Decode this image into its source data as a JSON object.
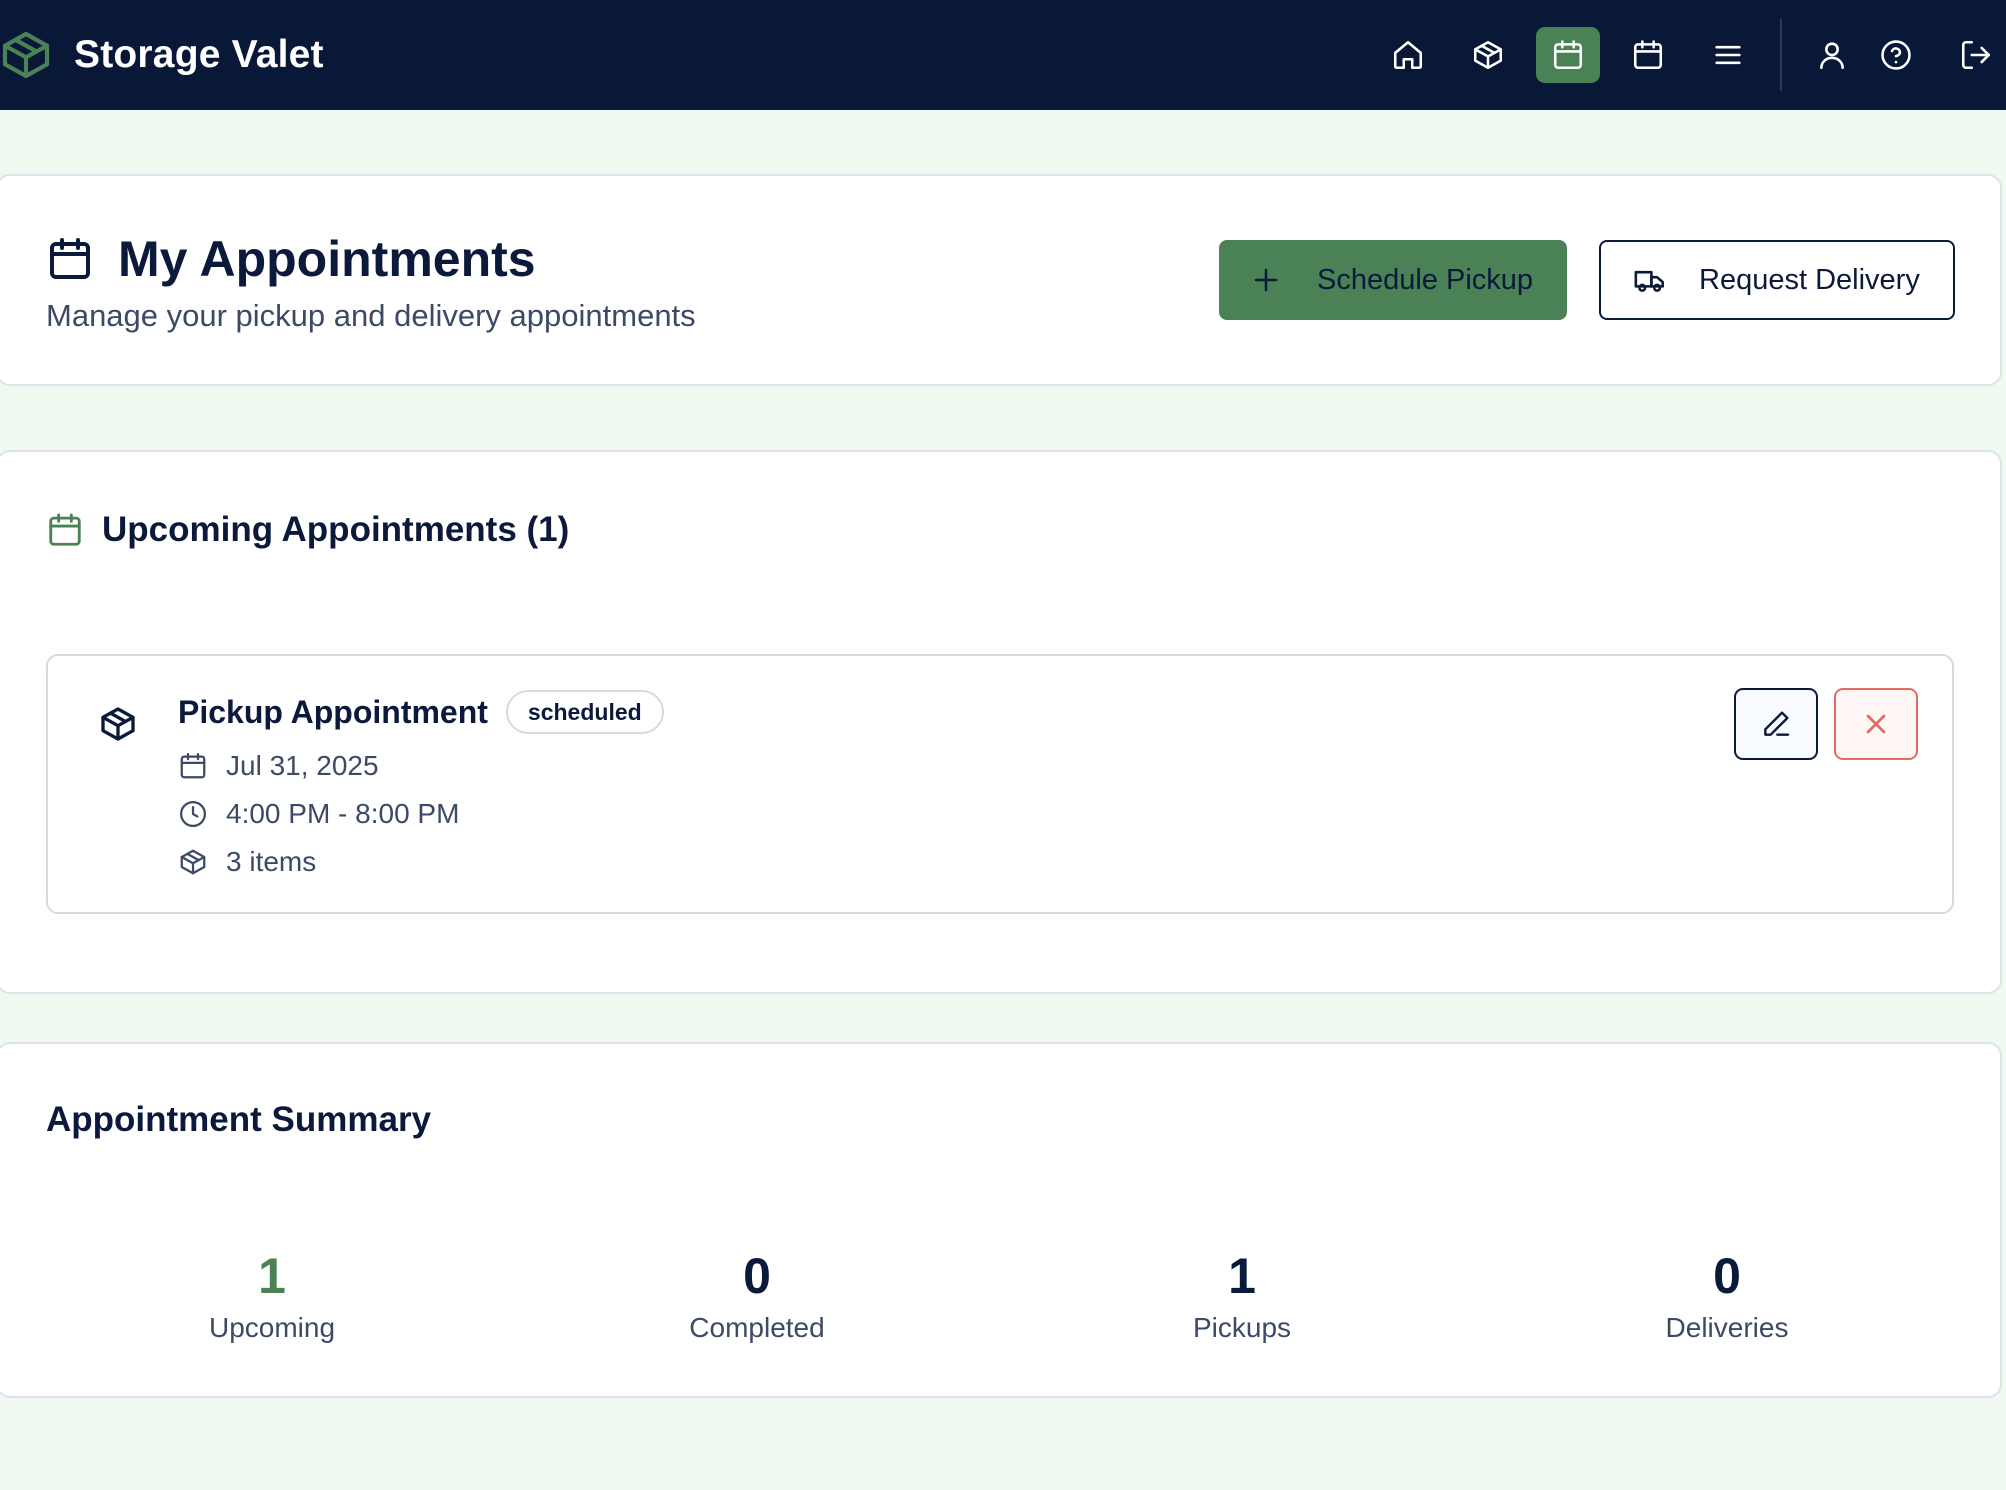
{
  "app": {
    "name": "Storage Valet",
    "logo_icon": "package-icon"
  },
  "nav": {
    "items": [
      {
        "name": "home",
        "icon": "home-icon",
        "active": false
      },
      {
        "name": "inventory",
        "icon": "package-icon",
        "active": false
      },
      {
        "name": "appointments",
        "icon": "calendar-icon",
        "active": true
      },
      {
        "name": "schedule",
        "icon": "calendar-icon",
        "active": false
      },
      {
        "name": "menu",
        "icon": "menu-icon",
        "active": false
      }
    ],
    "account_items": [
      {
        "name": "profile",
        "icon": "user-icon"
      },
      {
        "name": "help",
        "icon": "help-circle-icon"
      },
      {
        "name": "logout",
        "icon": "log-out-icon"
      }
    ]
  },
  "header": {
    "title": "My Appointments",
    "subtitle": "Manage your pickup and delivery appointments",
    "schedule_pickup_label": "Schedule Pickup",
    "request_delivery_label": "Request Delivery"
  },
  "upcoming": {
    "title": "Upcoming Appointments (1)",
    "appointments": [
      {
        "title": "Pickup Appointment",
        "status": "scheduled",
        "date": "Jul 31, 2025",
        "time": "4:00 PM - 8:00 PM",
        "items": "3 items"
      }
    ]
  },
  "summary": {
    "title": "Appointment Summary",
    "stats": [
      {
        "value": "1",
        "label": "Upcoming"
      },
      {
        "value": "0",
        "label": "Completed"
      },
      {
        "value": "1",
        "label": "Pickups"
      },
      {
        "value": "0",
        "label": "Deliveries"
      }
    ]
  },
  "colors": {
    "nav_bg": "#0a1838",
    "accent_green": "#4a8155",
    "page_bg": "#f0f8f2",
    "danger": "#e26a63",
    "text_primary": "#0b1a3b"
  }
}
